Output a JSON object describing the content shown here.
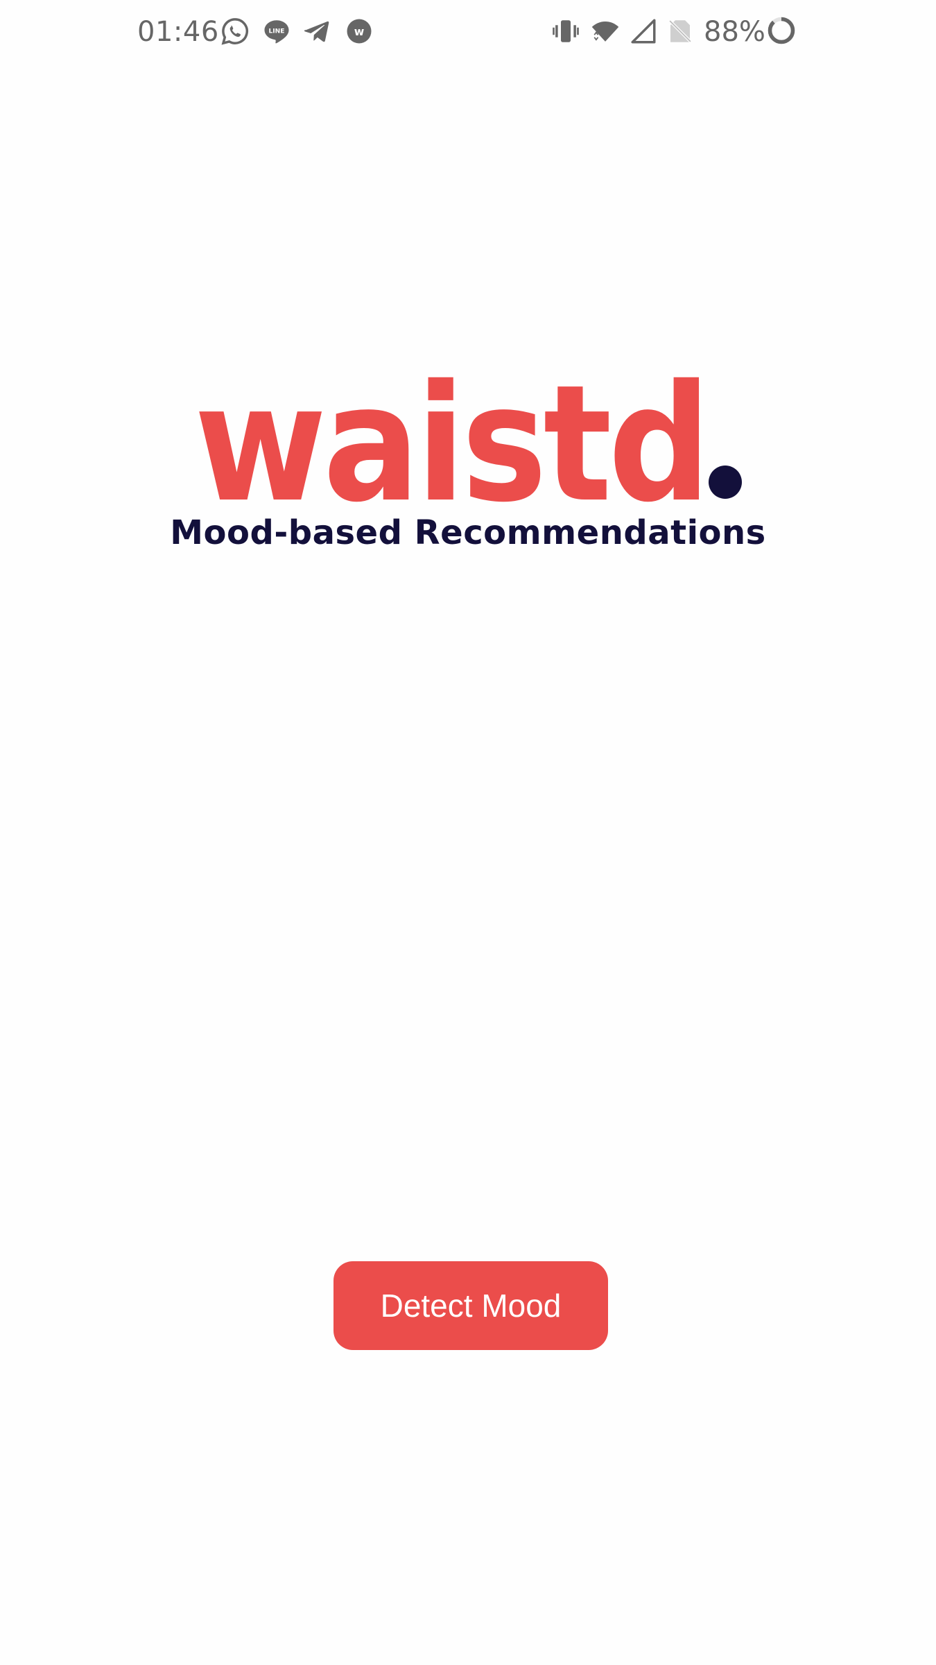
{
  "status_bar": {
    "time": "01:46",
    "battery_percent": "88%",
    "left_icons": [
      "whatsapp-icon",
      "line-icon",
      "telegram-icon",
      "w-app-icon"
    ],
    "right_icons": [
      "vibrate-icon",
      "wifi-icon",
      "cellular-signal-icon",
      "no-sim-icon",
      "battery-ring-icon"
    ]
  },
  "logo": {
    "wordmark": "waistd",
    "colors": {
      "wordmark": "#eb4d4b",
      "dot": "#13103b"
    }
  },
  "tagline": "Mood-based Recommendations",
  "actions": {
    "detect_mood_label": "Detect Mood"
  },
  "colors": {
    "accent": "#eb4d4b",
    "navy": "#13103b",
    "background": "#fefefe",
    "status_text": "#666666"
  }
}
